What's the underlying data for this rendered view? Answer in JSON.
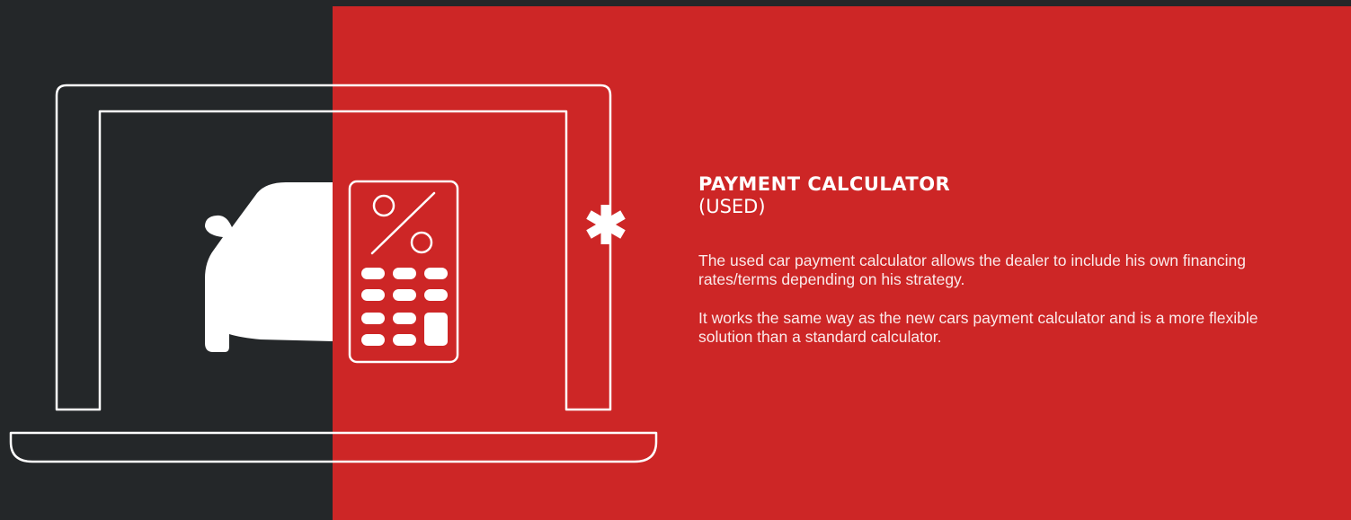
{
  "colors": {
    "dark_background": "#242729",
    "accent_red": "#cd2626",
    "foreground": "#ffffff"
  },
  "illustration": {
    "icons": [
      "laptop-icon",
      "car-icon",
      "calculator-icon",
      "percent-icon",
      "asterisk-icon"
    ]
  },
  "content": {
    "title": "PAYMENT CALCULATOR",
    "subtitle": "(USED)",
    "paragraphs": [
      "The used car payment calculator allows the dealer to include his own financing rates/terms depending on his strategy.",
      "It works the same way as the new cars payment calculator and is a more flexible solution than a standard calculator."
    ]
  }
}
